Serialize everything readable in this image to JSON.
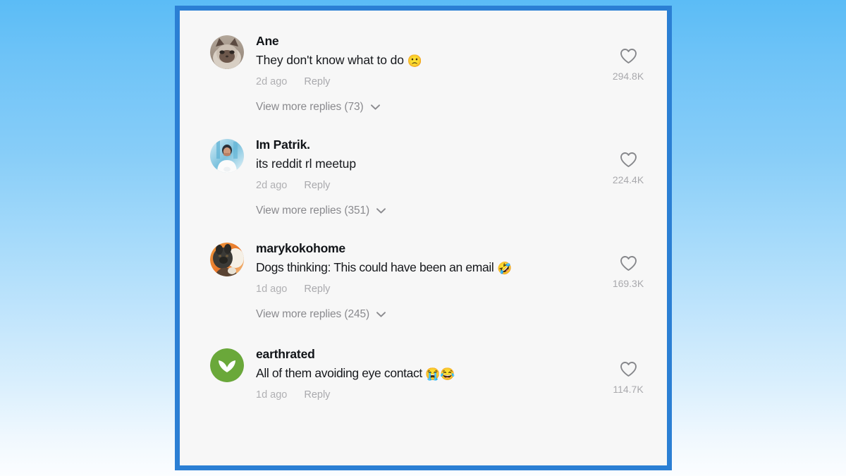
{
  "theme": {
    "card_border_color": "#2b7fd4",
    "card_background": "#f7f7f7",
    "background_top": "#5bbcf6",
    "background_bottom": "#fbfdff",
    "username_color": "#111418",
    "comment_text_color": "#16181c",
    "meta_color": "#b0b0b3",
    "like_count_color": "#a9a9ad",
    "heart_icon_color": "#86878b",
    "earthrated_avatar_color": "#6aa83a"
  },
  "comments": [
    {
      "username": "Ane",
      "text": "They don't know what to do ",
      "emoji": "🙁",
      "timestamp": "2d ago",
      "reply_label": "Reply",
      "like_count": "294.8K",
      "more_replies_label": "View more replies (73)",
      "reply_count": 73,
      "avatar_type": "cat-photo"
    },
    {
      "username": "Im Patrik.",
      "text": "its reddit rl meetup",
      "emoji": "",
      "timestamp": "2d ago",
      "reply_label": "Reply",
      "like_count": "224.4K",
      "more_replies_label": "View more replies (351)",
      "reply_count": 351,
      "avatar_type": "person-photo"
    },
    {
      "username": "marykokohome",
      "text": "Dogs thinking: This could have been an email ",
      "emoji": "🤣",
      "timestamp": "1d ago",
      "reply_label": "Reply",
      "like_count": "169.3K",
      "more_replies_label": "View more replies (245)",
      "reply_count": 245,
      "avatar_type": "dog-photo"
    },
    {
      "username": "earthrated",
      "text": "All of them avoiding eye contact ",
      "emoji": "😭😂",
      "timestamp": "1d ago",
      "reply_label": "Reply",
      "like_count": "114.7K",
      "more_replies_label": "",
      "reply_count": 0,
      "avatar_type": "green-leaf-logo"
    }
  ]
}
